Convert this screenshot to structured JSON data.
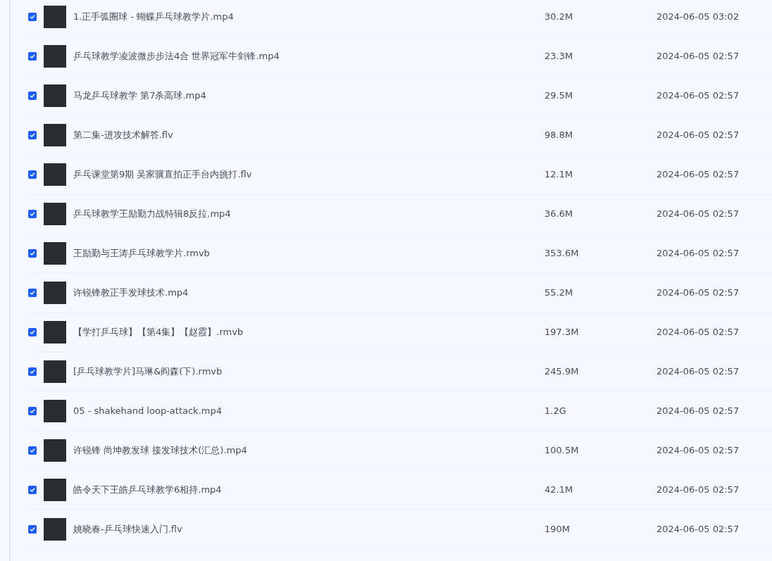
{
  "files": [
    {
      "name": "1.正手弧圈球 - 蝴蝶乒乓球教学片.mp4",
      "size": "30.2M",
      "date": "2024-06-05 03:02",
      "checked": true
    },
    {
      "name": "乒乓球教学凌波微步步法4合 世界冠军牛剑锋.mp4",
      "size": "23.3M",
      "date": "2024-06-05 02:57",
      "checked": true
    },
    {
      "name": "马龙乒乓球教学 第7杀高球.mp4",
      "size": "29.5M",
      "date": "2024-06-05 02:57",
      "checked": true
    },
    {
      "name": "第二集-进攻技术解答.flv",
      "size": "98.8M",
      "date": "2024-06-05 02:57",
      "checked": true
    },
    {
      "name": "乒乓课堂第9期 吴家骥直拍正手台内挑打.flv",
      "size": "12.1M",
      "date": "2024-06-05 02:57",
      "checked": true
    },
    {
      "name": "乒乓球教学王励勤力战特辑8反拉.mp4",
      "size": "36.6M",
      "date": "2024-06-05 02:57",
      "checked": true
    },
    {
      "name": "王励勤与王涛乒乓球教学片.rmvb",
      "size": "353.6M",
      "date": "2024-06-05 02:57",
      "checked": true
    },
    {
      "name": "许锐锋教正手发球技术.mp4",
      "size": "55.2M",
      "date": "2024-06-05 02:57",
      "checked": true
    },
    {
      "name": "【学打乒乓球】【第4集】【赵霞】.rmvb",
      "size": "197.3M",
      "date": "2024-06-05 02:57",
      "checked": true
    },
    {
      "name": "[乒乓球教学片]马琳&阎森(下).rmvb",
      "size": "245.9M",
      "date": "2024-06-05 02:57",
      "checked": true
    },
    {
      "name": "05 - shakehand loop-attack.mp4",
      "size": "1.2G",
      "date": "2024-06-05 02:57",
      "checked": true
    },
    {
      "name": "许锐锋 尚坤教发球 接发球技术(汇总).mp4",
      "size": "100.5M",
      "date": "2024-06-05 02:57",
      "checked": true
    },
    {
      "name": "皓令天下王皓乒乓球教学6相持.mp4",
      "size": "42.1M",
      "date": "2024-06-05 02:57",
      "checked": true
    },
    {
      "name": "姚晓春-乒乓球快速入门.flv",
      "size": "190M",
      "date": "2024-06-05 02:57",
      "checked": true
    }
  ]
}
